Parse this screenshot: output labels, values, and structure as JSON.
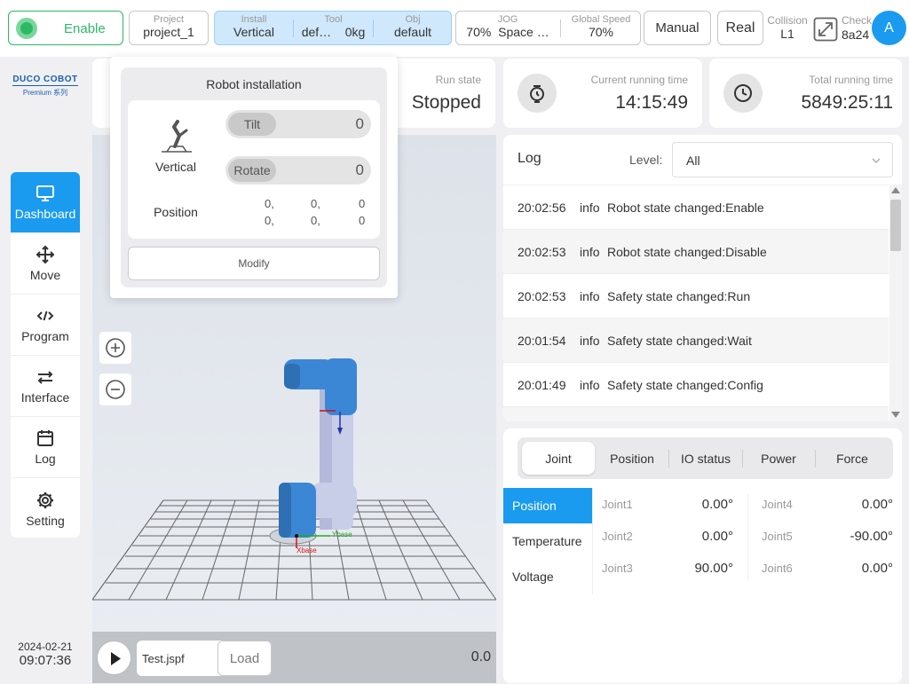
{
  "topbar": {
    "enable_label": "Enable",
    "project": {
      "label": "Project",
      "value": "project_1"
    },
    "install": {
      "label": "Install",
      "value": "Vertical"
    },
    "tool": {
      "label": "Tool",
      "name": "def…",
      "mass": "0kg"
    },
    "obj": {
      "label": "Obj",
      "value": "default"
    },
    "jog": {
      "label": "JOG",
      "value1": "70%",
      "value2": "Space …"
    },
    "global_speed": {
      "label": "Global Speed",
      "value": "70%"
    },
    "mode_button": "Manual",
    "real_button": "Real",
    "collision": {
      "label": "Collision",
      "value": "L1"
    },
    "check": {
      "label": "Check",
      "value": "8a24"
    },
    "avatar": "A"
  },
  "brand": {
    "logo": "DUCO COBOT",
    "sub": "Premium 系列"
  },
  "sidebar": {
    "items": [
      {
        "label": "Dashboard",
        "icon": "monitor-icon"
      },
      {
        "label": "Move",
        "icon": "move-arrows-icon"
      },
      {
        "label": "Program",
        "icon": "code-icon"
      },
      {
        "label": "Interface",
        "icon": "swap-arrows-icon"
      },
      {
        "label": "Log",
        "icon": "calendar-icon"
      },
      {
        "label": "Setting",
        "icon": "gear-icon"
      }
    ],
    "date": "2024-02-21",
    "time": "09:07:36"
  },
  "status": {
    "run_state": {
      "label": "Run state",
      "value": "Stopped"
    },
    "current_time": {
      "label": "Current running time",
      "value": "14:15:49"
    },
    "total_time": {
      "label": "Total running time",
      "value": "5849:25:11"
    }
  },
  "popup": {
    "title": "Robot installation",
    "install_type": "Vertical",
    "tilt": {
      "label": "Tilt",
      "value": "0"
    },
    "rotate": {
      "label": "Rotate",
      "value": "0"
    },
    "position_label": "Position",
    "position_row1": [
      "0,",
      "0,",
      "0"
    ],
    "position_row2": [
      "0,",
      "0,",
      "0"
    ],
    "modify_button": "Modify"
  },
  "viewer": {
    "zoom_in": "+",
    "zoom_out": "−",
    "x_axis": "Xbase",
    "y_axis": "Ybase",
    "file_name": "Test.jspf",
    "load_button": "Load",
    "progress_value": "0.0"
  },
  "log": {
    "title": "Log",
    "level_label": "Level:",
    "level_value": "All",
    "rows": [
      {
        "time": "20:02:56",
        "level": "info",
        "message": "Robot state changed:Enable"
      },
      {
        "time": "20:02:53",
        "level": "info",
        "message": "Robot state changed:Disable"
      },
      {
        "time": "20:02:53",
        "level": "info",
        "message": "Safety state changed:Run"
      },
      {
        "time": "20:01:54",
        "level": "info",
        "message": "Safety state changed:Wait"
      },
      {
        "time": "20:01:49",
        "level": "info",
        "message": "Safety state changed:Config"
      }
    ]
  },
  "joints_panel": {
    "tabs": [
      "Joint",
      "Position",
      "IO status",
      "Power",
      "Force"
    ],
    "subtabs": [
      "Position",
      "Temperature",
      "Voltage"
    ],
    "joints": [
      {
        "name": "Joint1",
        "value": "0.00°"
      },
      {
        "name": "Joint2",
        "value": "0.00°"
      },
      {
        "name": "Joint3",
        "value": "90.00°"
      },
      {
        "name": "Joint4",
        "value": "0.00°"
      },
      {
        "name": "Joint5",
        "value": "-90.00°"
      },
      {
        "name": "Joint6",
        "value": "0.00°"
      }
    ]
  },
  "colors": {
    "accent": "#1a9bf0",
    "enable_green": "#2db866",
    "robot_blue": "#3b87d6"
  }
}
